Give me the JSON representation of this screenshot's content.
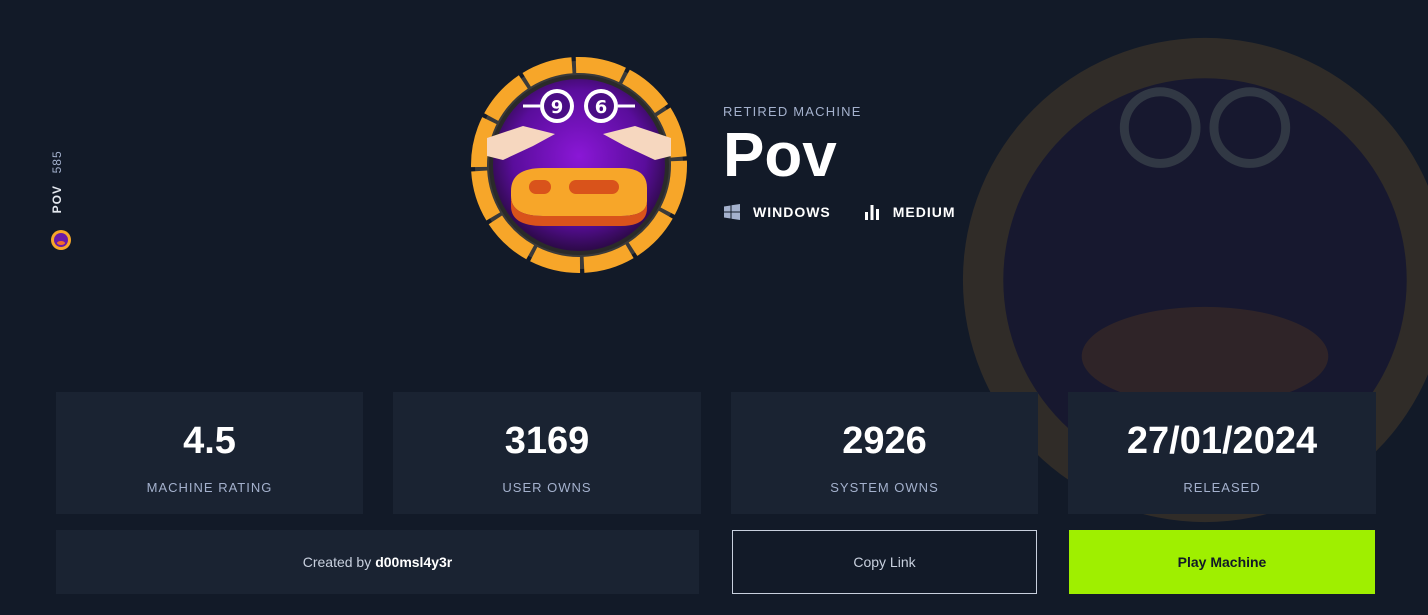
{
  "side": {
    "name": "POV",
    "number": "585"
  },
  "machine": {
    "status": "RETIRED MACHINE",
    "name": "Pov",
    "os": "WINDOWS",
    "difficulty": "MEDIUM",
    "avatar_icon": "pov-machine-avatar"
  },
  "stats": [
    {
      "value": "4.5",
      "label": "MACHINE RATING"
    },
    {
      "value": "3169",
      "label": "USER OWNS"
    },
    {
      "value": "2926",
      "label": "SYSTEM OWNS"
    },
    {
      "value": "27/01/2024",
      "label": "RELEASED"
    }
  ],
  "creator": {
    "prefix": "Created by",
    "name": "d00msl4y3r"
  },
  "actions": {
    "copy_link": "Copy Link",
    "play": "Play Machine"
  },
  "colors": {
    "accent": "#9fef00",
    "card": "#1a2332",
    "background": "#121a28",
    "avatar_ring": "#f7a629"
  }
}
